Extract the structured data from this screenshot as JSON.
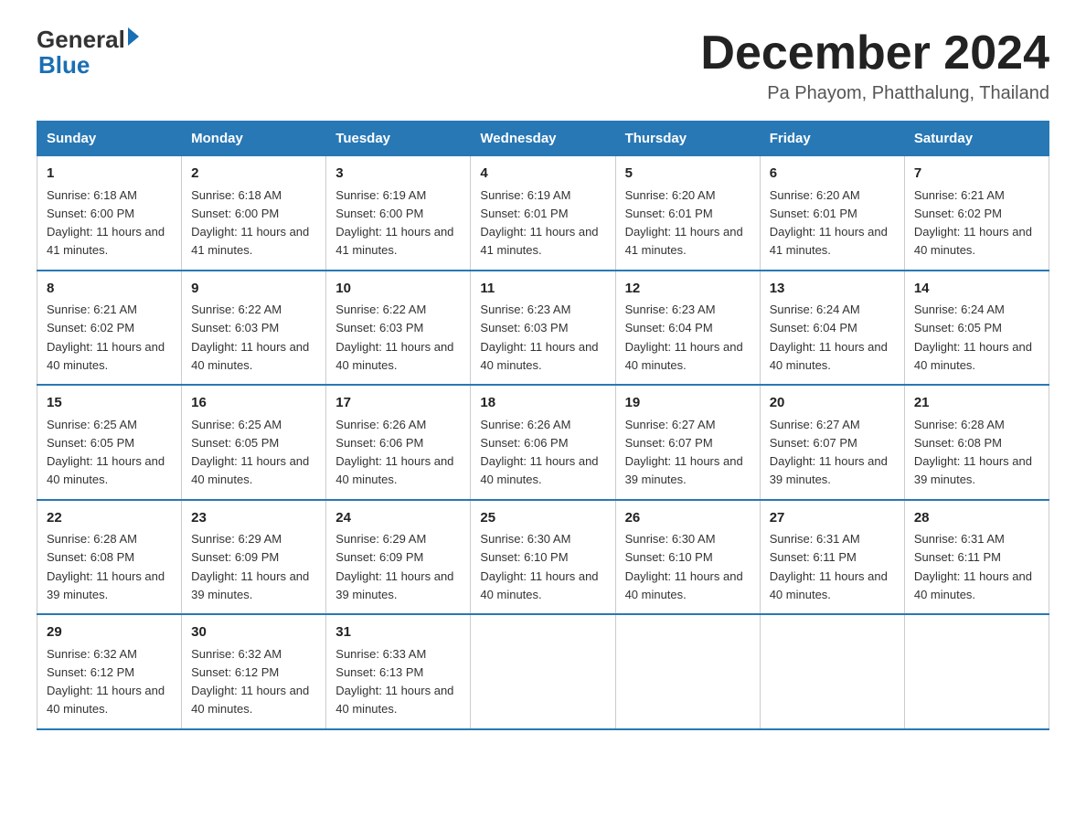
{
  "logo": {
    "line1": "General",
    "arrow": true,
    "line2": "Blue"
  },
  "title": "December 2024",
  "location": "Pa Phayom, Phatthalung, Thailand",
  "days_header": [
    "Sunday",
    "Monday",
    "Tuesday",
    "Wednesday",
    "Thursday",
    "Friday",
    "Saturday"
  ],
  "weeks": [
    [
      {
        "day": "1",
        "sunrise": "6:18 AM",
        "sunset": "6:00 PM",
        "daylight": "11 hours and 41 minutes."
      },
      {
        "day": "2",
        "sunrise": "6:18 AM",
        "sunset": "6:00 PM",
        "daylight": "11 hours and 41 minutes."
      },
      {
        "day": "3",
        "sunrise": "6:19 AM",
        "sunset": "6:00 PM",
        "daylight": "11 hours and 41 minutes."
      },
      {
        "day": "4",
        "sunrise": "6:19 AM",
        "sunset": "6:01 PM",
        "daylight": "11 hours and 41 minutes."
      },
      {
        "day": "5",
        "sunrise": "6:20 AM",
        "sunset": "6:01 PM",
        "daylight": "11 hours and 41 minutes."
      },
      {
        "day": "6",
        "sunrise": "6:20 AM",
        "sunset": "6:01 PM",
        "daylight": "11 hours and 41 minutes."
      },
      {
        "day": "7",
        "sunrise": "6:21 AM",
        "sunset": "6:02 PM",
        "daylight": "11 hours and 40 minutes."
      }
    ],
    [
      {
        "day": "8",
        "sunrise": "6:21 AM",
        "sunset": "6:02 PM",
        "daylight": "11 hours and 40 minutes."
      },
      {
        "day": "9",
        "sunrise": "6:22 AM",
        "sunset": "6:03 PM",
        "daylight": "11 hours and 40 minutes."
      },
      {
        "day": "10",
        "sunrise": "6:22 AM",
        "sunset": "6:03 PM",
        "daylight": "11 hours and 40 minutes."
      },
      {
        "day": "11",
        "sunrise": "6:23 AM",
        "sunset": "6:03 PM",
        "daylight": "11 hours and 40 minutes."
      },
      {
        "day": "12",
        "sunrise": "6:23 AM",
        "sunset": "6:04 PM",
        "daylight": "11 hours and 40 minutes."
      },
      {
        "day": "13",
        "sunrise": "6:24 AM",
        "sunset": "6:04 PM",
        "daylight": "11 hours and 40 minutes."
      },
      {
        "day": "14",
        "sunrise": "6:24 AM",
        "sunset": "6:05 PM",
        "daylight": "11 hours and 40 minutes."
      }
    ],
    [
      {
        "day": "15",
        "sunrise": "6:25 AM",
        "sunset": "6:05 PM",
        "daylight": "11 hours and 40 minutes."
      },
      {
        "day": "16",
        "sunrise": "6:25 AM",
        "sunset": "6:05 PM",
        "daylight": "11 hours and 40 minutes."
      },
      {
        "day": "17",
        "sunrise": "6:26 AM",
        "sunset": "6:06 PM",
        "daylight": "11 hours and 40 minutes."
      },
      {
        "day": "18",
        "sunrise": "6:26 AM",
        "sunset": "6:06 PM",
        "daylight": "11 hours and 40 minutes."
      },
      {
        "day": "19",
        "sunrise": "6:27 AM",
        "sunset": "6:07 PM",
        "daylight": "11 hours and 39 minutes."
      },
      {
        "day": "20",
        "sunrise": "6:27 AM",
        "sunset": "6:07 PM",
        "daylight": "11 hours and 39 minutes."
      },
      {
        "day": "21",
        "sunrise": "6:28 AM",
        "sunset": "6:08 PM",
        "daylight": "11 hours and 39 minutes."
      }
    ],
    [
      {
        "day": "22",
        "sunrise": "6:28 AM",
        "sunset": "6:08 PM",
        "daylight": "11 hours and 39 minutes."
      },
      {
        "day": "23",
        "sunrise": "6:29 AM",
        "sunset": "6:09 PM",
        "daylight": "11 hours and 39 minutes."
      },
      {
        "day": "24",
        "sunrise": "6:29 AM",
        "sunset": "6:09 PM",
        "daylight": "11 hours and 39 minutes."
      },
      {
        "day": "25",
        "sunrise": "6:30 AM",
        "sunset": "6:10 PM",
        "daylight": "11 hours and 40 minutes."
      },
      {
        "day": "26",
        "sunrise": "6:30 AM",
        "sunset": "6:10 PM",
        "daylight": "11 hours and 40 minutes."
      },
      {
        "day": "27",
        "sunrise": "6:31 AM",
        "sunset": "6:11 PM",
        "daylight": "11 hours and 40 minutes."
      },
      {
        "day": "28",
        "sunrise": "6:31 AM",
        "sunset": "6:11 PM",
        "daylight": "11 hours and 40 minutes."
      }
    ],
    [
      {
        "day": "29",
        "sunrise": "6:32 AM",
        "sunset": "6:12 PM",
        "daylight": "11 hours and 40 minutes."
      },
      {
        "day": "30",
        "sunrise": "6:32 AM",
        "sunset": "6:12 PM",
        "daylight": "11 hours and 40 minutes."
      },
      {
        "day": "31",
        "sunrise": "6:33 AM",
        "sunset": "6:13 PM",
        "daylight": "11 hours and 40 minutes."
      },
      null,
      null,
      null,
      null
    ]
  ]
}
